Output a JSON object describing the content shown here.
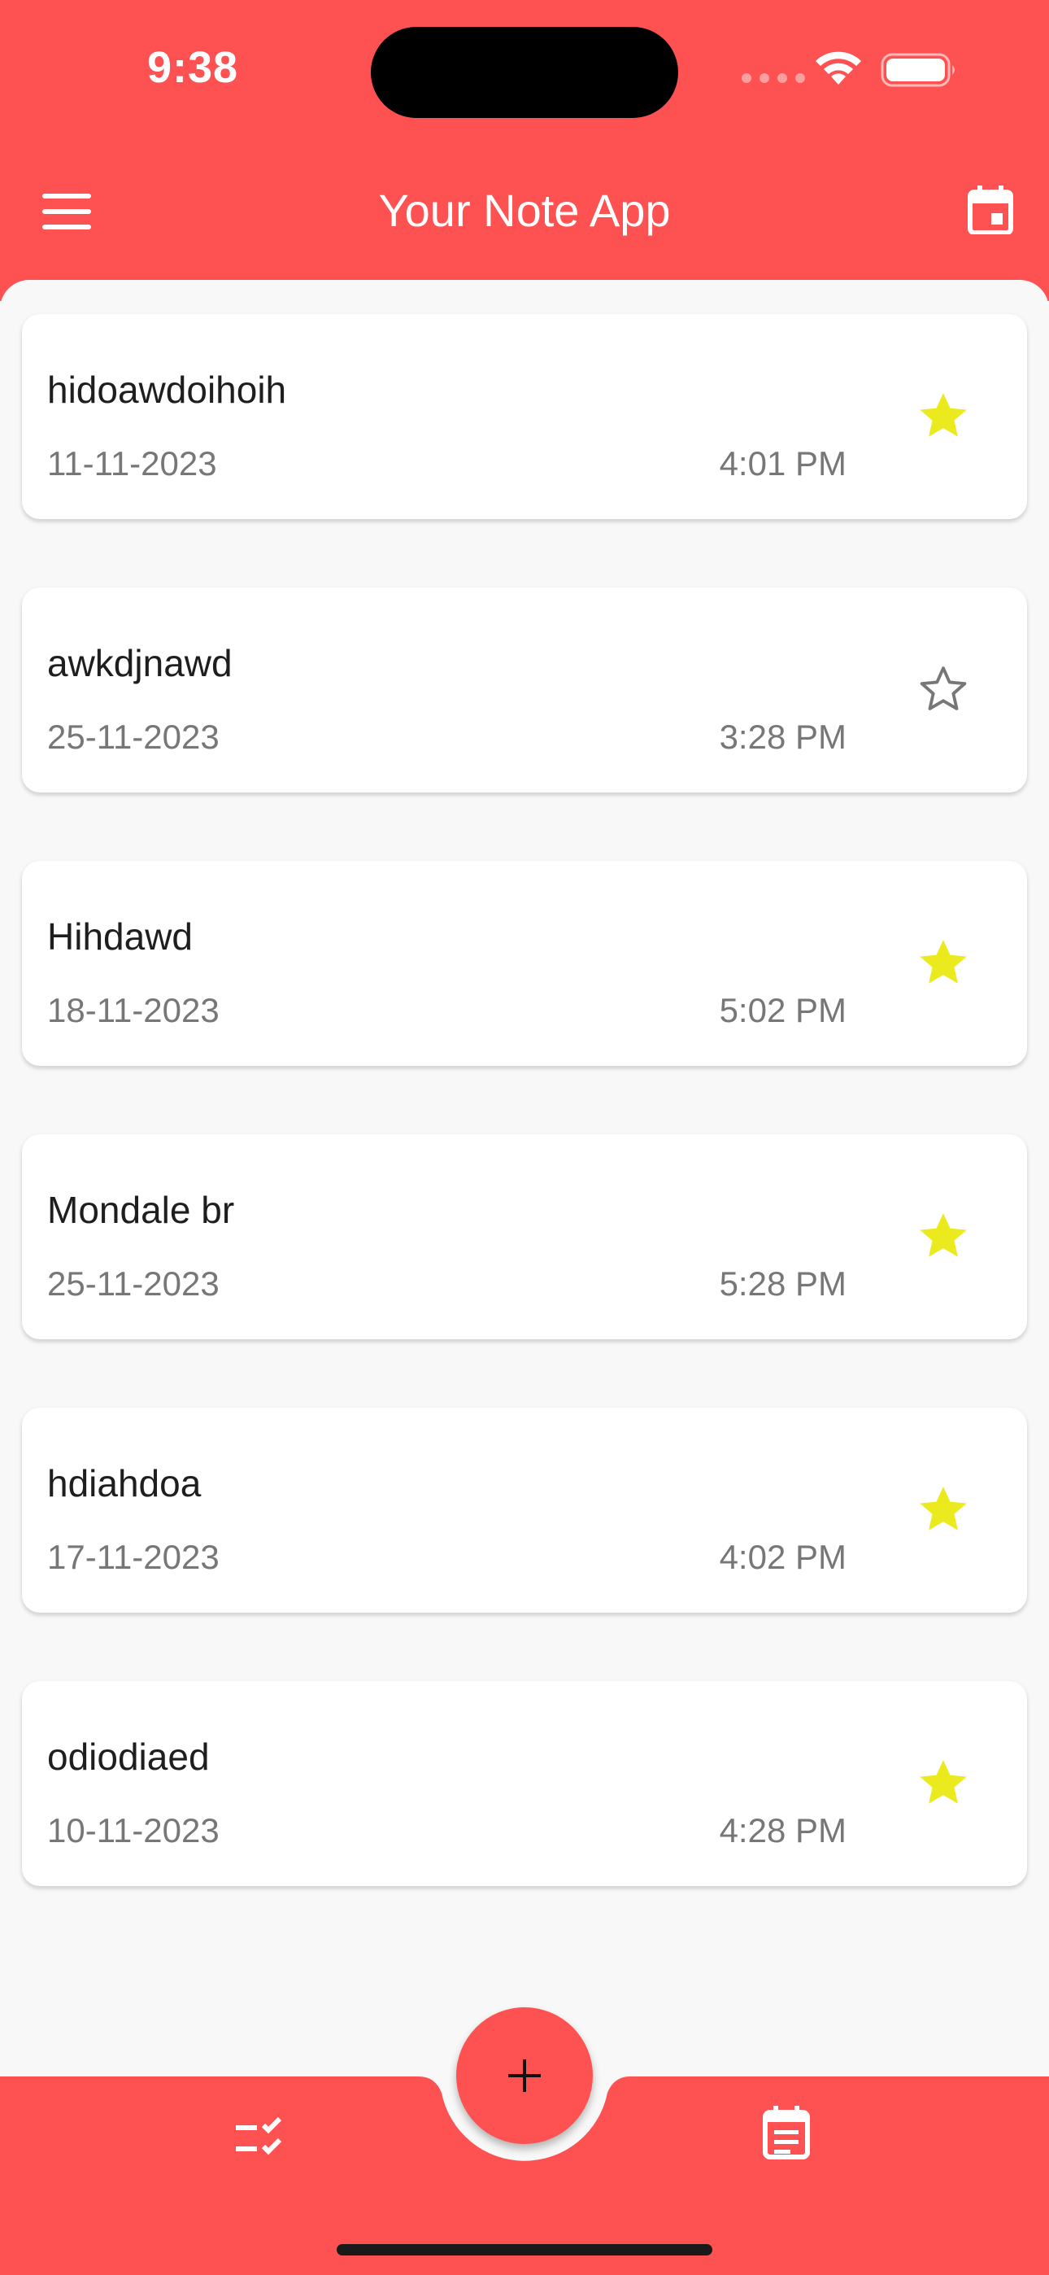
{
  "status_bar": {
    "time": "9:38"
  },
  "app_bar": {
    "title": "Your Note App",
    "left_icon": "menu-icon",
    "right_icon": "calendar-icon"
  },
  "notes": [
    {
      "title": "hidoawdoihoih",
      "date": "11-11-2023",
      "time": "4:01 PM",
      "favorite": true
    },
    {
      "title": "awkdjnawd",
      "date": "25-11-2023",
      "time": "3:28 PM",
      "favorite": false
    },
    {
      "title": "Hihdawd",
      "date": "18-11-2023",
      "time": "5:02 PM",
      "favorite": true
    },
    {
      "title": "Mondale br",
      "date": "25-11-2023",
      "time": "5:28 PM",
      "favorite": true
    },
    {
      "title": "hdiahdoa",
      "date": "17-11-2023",
      "time": "4:02 PM",
      "favorite": true
    },
    {
      "title": "odiodiaed",
      "date": "10-11-2023",
      "time": "4:28 PM",
      "favorite": true
    }
  ],
  "bottom_nav": {
    "left_icon": "checklist-icon",
    "fab_icon": "plus-icon",
    "right_icon": "event-note-icon"
  },
  "colors": {
    "primary": "#fe5151",
    "star_active": "#eaea1e",
    "star_inactive": "#777777",
    "background": "#f8f8f8"
  }
}
